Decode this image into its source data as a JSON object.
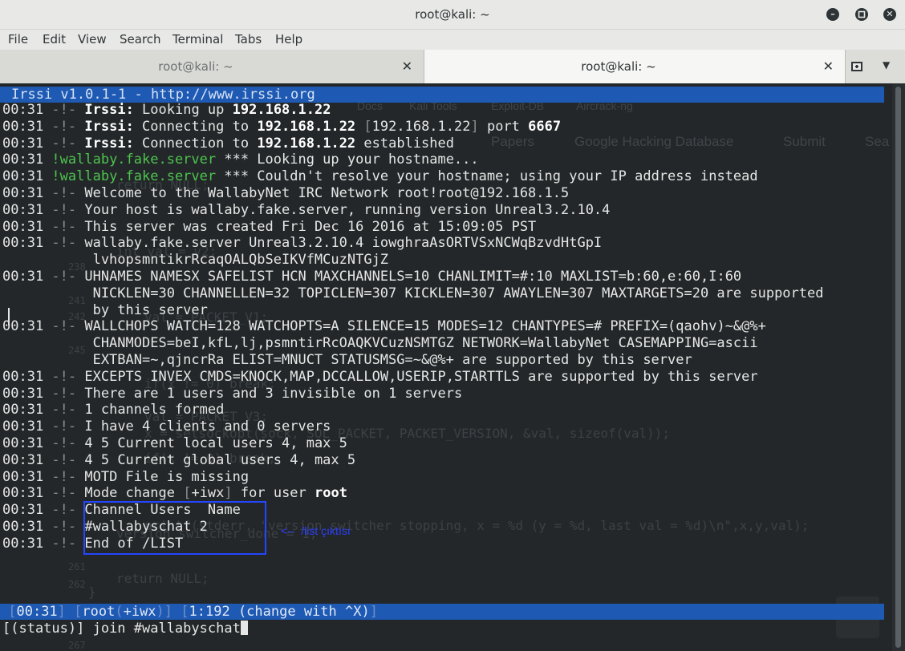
{
  "window": {
    "title": "root@kali: ~",
    "controls": {
      "minimize_icon": "minimize-icon",
      "maximize_icon": "maximize-icon",
      "close_icon": "close-icon"
    }
  },
  "menu": [
    "File",
    "Edit",
    "View",
    "Search",
    "Terminal",
    "Tabs",
    "Help"
  ],
  "tabs": [
    {
      "label": "root@kali: ~",
      "active": false
    },
    {
      "label": "root@kali: ~",
      "active": true
    }
  ],
  "irssi": {
    "header": "Irssi v1.0.1-1 - http://www.irssi.org",
    "lines": [
      [
        {
          "t": "00:31 "
        },
        {
          "t": "-!-",
          "c": "grey"
        },
        {
          "t": " "
        },
        {
          "t": "Irssi:",
          "c": "hl"
        },
        {
          "t": " Looking up "
        },
        {
          "t": "192.168.1.22",
          "c": "hl"
        }
      ],
      [
        {
          "t": "00:31 "
        },
        {
          "t": "-!-",
          "c": "grey"
        },
        {
          "t": " "
        },
        {
          "t": "Irssi:",
          "c": "hl"
        },
        {
          "t": " Connecting to "
        },
        {
          "t": "192.168.1.22",
          "c": "hl"
        },
        {
          "t": " [",
          "c": "grey"
        },
        {
          "t": "192.168.1.22"
        },
        {
          "t": "]",
          "c": "grey"
        },
        {
          "t": " port "
        },
        {
          "t": "6667",
          "c": "hl"
        }
      ],
      [
        {
          "t": "00:31 "
        },
        {
          "t": "-!-",
          "c": "grey"
        },
        {
          "t": " "
        },
        {
          "t": "Irssi:",
          "c": "hl"
        },
        {
          "t": " Connection to "
        },
        {
          "t": "192.168.1.22",
          "c": "hl"
        },
        {
          "t": " established"
        }
      ],
      [
        {
          "t": "00:31 "
        },
        {
          "t": "!wallaby.fake.server",
          "c": "green"
        },
        {
          "t": " *** Looking up your hostname..."
        }
      ],
      [
        {
          "t": "00:31 "
        },
        {
          "t": "!wallaby.fake.server",
          "c": "green"
        },
        {
          "t": " *** Couldn't resolve your hostname; using your IP address instead"
        }
      ],
      [
        {
          "t": "00:31 "
        },
        {
          "t": "-!-",
          "c": "grey"
        },
        {
          "t": " Welcome to the WallabyNet IRC Network root!root@192.168.1.5"
        }
      ],
      [
        {
          "t": "00:31 "
        },
        {
          "t": "-!-",
          "c": "grey"
        },
        {
          "t": " Your host is wallaby.fake.server, running version Unreal3.2.10.4"
        }
      ],
      [
        {
          "t": "00:31 "
        },
        {
          "t": "-!-",
          "c": "grey"
        },
        {
          "t": " This server was created Fri Dec 16 2016 at 15:09:05 PST"
        }
      ],
      [
        {
          "t": "00:31 "
        },
        {
          "t": "-!-",
          "c": "grey"
        },
        {
          "t": " wallaby.fake.server Unreal3.2.10.4 iowghraAsORTVSxNCWqBzvdHtGpI"
        }
      ],
      [
        {
          "t": "           lvhopsmntikrRcaqOALQbSeIKVfMCuzNTGjZ"
        }
      ],
      [
        {
          "t": "00:31 "
        },
        {
          "t": "-!-",
          "c": "grey"
        },
        {
          "t": " UHNAMES NAMESX SAFELIST HCN MAXCHANNELS=10 CHANLIMIT=#:10 MAXLIST=b:60,e:60,I:60"
        }
      ],
      [
        {
          "t": "           NICKLEN=30 CHANNELLEN=32 TOPICLEN=307 KICKLEN=307 AWAYLEN=307 MAXTARGETS=20 are supported"
        }
      ],
      [
        {
          "t": "           by this server"
        }
      ],
      [
        {
          "t": "00:31 "
        },
        {
          "t": "-!-",
          "c": "grey"
        },
        {
          "t": " WALLCHOPS WATCH=128 WATCHOPTS=A SILENCE=15 MODES=12 CHANTYPES=# PREFIX=(qaohv)~&@%+"
        }
      ],
      [
        {
          "t": "           CHANMODES=beI,kfL,lj,psmntirRcOAQKVCuzNSMTGZ NETWORK=WallabyNet CASEMAPPING=ascii"
        }
      ],
      [
        {
          "t": "           EXTBAN=~,qjncrRa ELIST=MNUCT STATUSMSG=~&@%+ are supported by this server"
        }
      ],
      [
        {
          "t": "00:31 "
        },
        {
          "t": "-!-",
          "c": "grey"
        },
        {
          "t": " EXCEPTS INVEX CMDS=KNOCK,MAP,DCCALLOW,USERIP,STARTTLS are supported by this server"
        }
      ],
      [
        {
          "t": "00:31 "
        },
        {
          "t": "-!-",
          "c": "grey"
        },
        {
          "t": " There are 1 users and 3 invisible on 1 servers"
        }
      ],
      [
        {
          "t": "00:31 "
        },
        {
          "t": "-!-",
          "c": "grey"
        },
        {
          "t": " 1 channels formed"
        }
      ],
      [
        {
          "t": "00:31 "
        },
        {
          "t": "-!-",
          "c": "grey"
        },
        {
          "t": " I have 4 clients and 0 servers"
        }
      ],
      [
        {
          "t": "00:31 "
        },
        {
          "t": "-!-",
          "c": "grey"
        },
        {
          "t": " 4 5 Current local users 4, max 5"
        }
      ],
      [
        {
          "t": "00:31 "
        },
        {
          "t": "-!-",
          "c": "grey"
        },
        {
          "t": " 4 5 Current global users 4, max 5"
        }
      ],
      [
        {
          "t": "00:31 "
        },
        {
          "t": "-!-",
          "c": "grey"
        },
        {
          "t": " MOTD File is missing"
        }
      ],
      [
        {
          "t": "00:31 "
        },
        {
          "t": "-!-",
          "c": "grey"
        },
        {
          "t": " Mode change "
        },
        {
          "t": "[",
          "c": "grey"
        },
        {
          "t": "+iwx"
        },
        {
          "t": "]",
          "c": "grey"
        },
        {
          "t": " for user "
        },
        {
          "t": "root",
          "c": "hl"
        }
      ],
      [
        {
          "t": "00:31 "
        },
        {
          "t": "-!-",
          "c": "grey"
        },
        {
          "t": " Channel Users  Name"
        }
      ],
      [
        {
          "t": "00:31 "
        },
        {
          "t": "-!-",
          "c": "grey"
        },
        {
          "t": " #wallabyschat 2"
        }
      ],
      [
        {
          "t": "00:31 "
        },
        {
          "t": "-!-",
          "c": "grey"
        },
        {
          "t": " End of /LIST"
        }
      ]
    ],
    "status": {
      "time": "00:31",
      "user": "root",
      "mode": "+iwx",
      "window": "1:192",
      "hint": "(change with ^X)"
    },
    "prompt": "[(status)] join #wallabyschat"
  },
  "annotation": {
    "arrow_text": "<--  /list çıktısı",
    "box_color": "#2446ff"
  },
  "background_browser": {
    "bookmarks": [
      "Docs",
      "Kali Tools",
      "Exploit-DB",
      "Aircrack-ng"
    ],
    "nav": [
      "Papers",
      "Google Hacking Database",
      "Submit",
      "Sea"
    ],
    "code": [
      "return NULL;",
      "int val = v2;",
      "val = PACKET_V1;",
      "if(x != 0) break;",
      "val = PACKET_V3;",
      "x = setsockopt(sock, SOL_PACKET, PACKET_VERSION, &val, sizeof(val));",
      "if(x != 0) break;",
      "printf(stderr, \"version switcher stopping, x = %d (y = %d, last val = %d)\\n\",x,y,val);",
      "version_switcher_done = 1;",
      "return NULL;",
      "}"
    ],
    "line_numbers": [
      "238",
      "241",
      "242",
      "245",
      "261",
      "262",
      "267"
    ]
  }
}
